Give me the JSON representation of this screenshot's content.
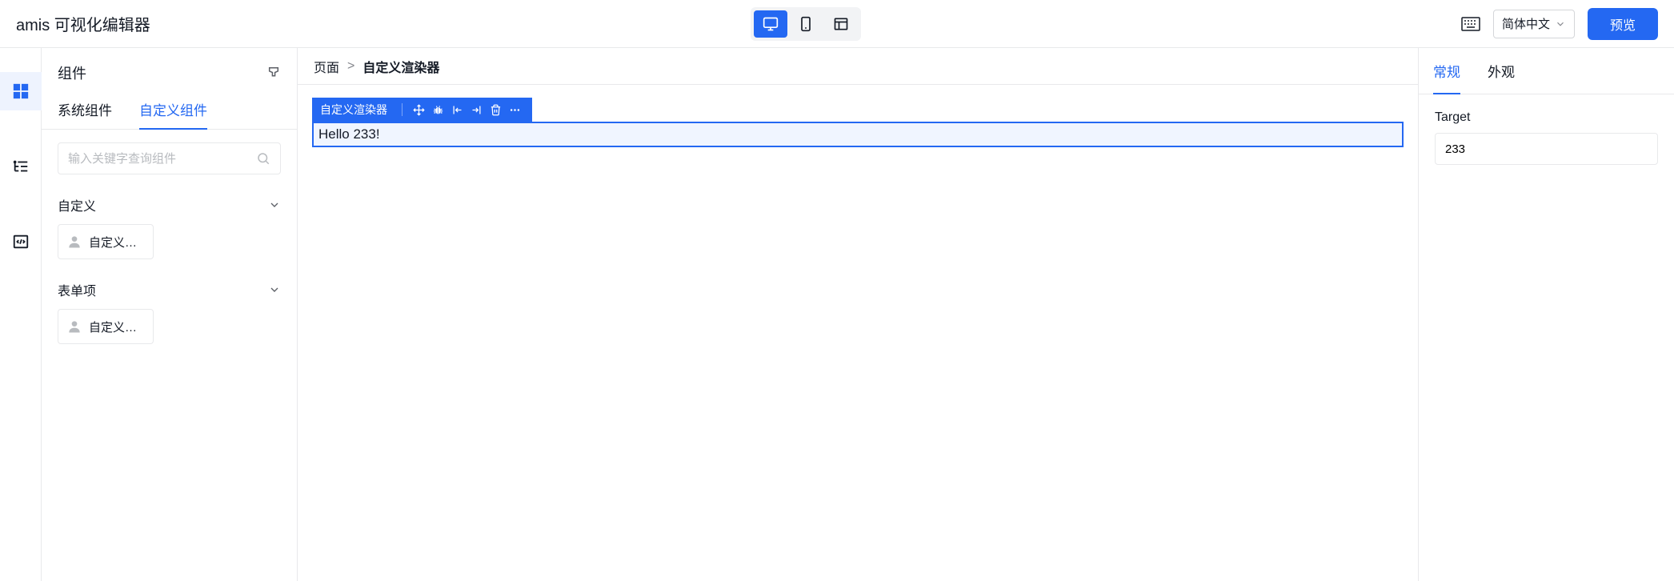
{
  "header": {
    "app_title": "amis 可视化编辑器",
    "language": "简体中文",
    "preview_label": "预览"
  },
  "left_panel": {
    "title": "组件",
    "tabs": [
      "系统组件",
      "自定义组件"
    ],
    "active_tab": 1,
    "search_placeholder": "输入关键字查询组件",
    "sections": [
      {
        "title": "自定义",
        "items": [
          {
            "label": "自定义渲..."
          }
        ]
      },
      {
        "title": "表单项",
        "items": [
          {
            "label": "自定义渲..."
          }
        ]
      }
    ]
  },
  "breadcrumb": {
    "root": "页面",
    "current": "自定义渲染器"
  },
  "canvas": {
    "selected_label": "自定义渲染器",
    "content": "Hello 233!"
  },
  "right_panel": {
    "tabs": [
      "常规",
      "外观"
    ],
    "active_tab": 0,
    "field_label": "Target",
    "field_value": "233"
  }
}
